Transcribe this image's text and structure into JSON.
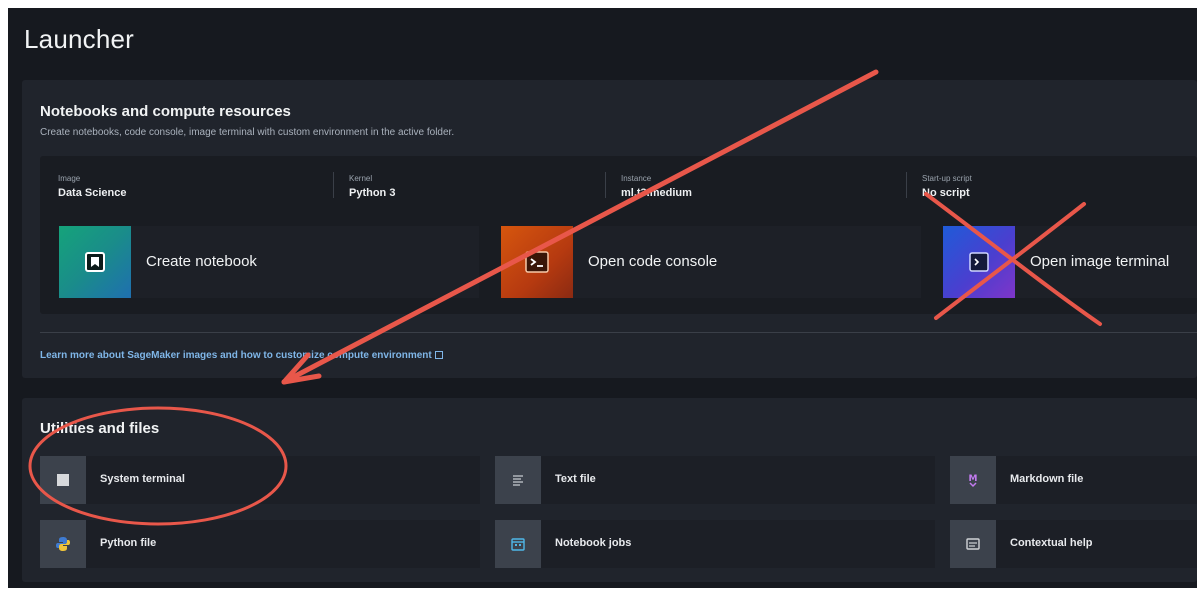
{
  "launcher": {
    "title": "Launcher"
  },
  "notebooks_panel": {
    "title": "Notebooks and compute resources",
    "subtitle": "Create notebooks, code console, image terminal with custom environment in the active folder.",
    "environment": [
      {
        "label": "Image",
        "value": "Data Science"
      },
      {
        "label": "Kernel",
        "value": "Python 3"
      },
      {
        "label": "Instance",
        "value": "ml.t3.medium"
      },
      {
        "label": "Start-up script",
        "value": "No script"
      }
    ],
    "actions": [
      {
        "label": "Create notebook",
        "icon": "notebook-icon"
      },
      {
        "label": "Open code console",
        "icon": "console-icon"
      },
      {
        "label": "Open image terminal",
        "icon": "image-terminal-icon"
      }
    ],
    "learn_more": "Learn more about SageMaker images and how to customize compute environment"
  },
  "utilities_panel": {
    "title": "Utilities and files",
    "items": [
      {
        "label": "System terminal",
        "icon": "terminal-icon"
      },
      {
        "label": "Text file",
        "icon": "text-file-icon"
      },
      {
        "label": "Markdown file",
        "icon": "markdown-icon"
      },
      {
        "label": "Python file",
        "icon": "python-icon"
      },
      {
        "label": "Notebook jobs",
        "icon": "calendar-icon"
      },
      {
        "label": "Contextual help",
        "icon": "help-panel-icon"
      }
    ]
  },
  "colors": {
    "background": "#16191f",
    "panel": "#20242c",
    "annotation": "#e8574a",
    "link": "#7fb6e8"
  }
}
